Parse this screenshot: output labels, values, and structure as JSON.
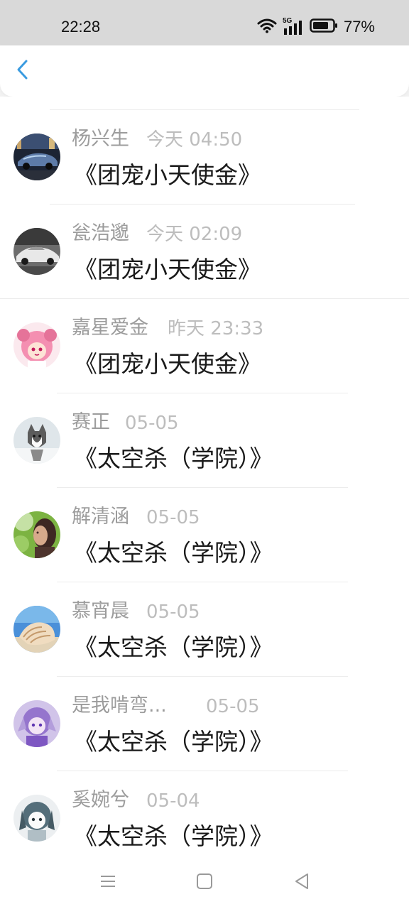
{
  "status_bar": {
    "time": "22:28",
    "battery_percent": "77%",
    "network_label": "5G"
  },
  "header": {
    "back_icon": "chevron-left-icon",
    "accent_color": "#3a9be0"
  },
  "list": {
    "items": [
      {
        "name": "杨兴生",
        "date": "今天 04:50",
        "title": "《团宠小天使金》",
        "avatar": "car-photo"
      },
      {
        "name": "瓮浩邈",
        "date": "今天 02:09",
        "title": "《团宠小天使金》",
        "avatar": "white-car-photo"
      },
      {
        "name": "嘉星爱金",
        "date": "昨天 23:33",
        "title": "《团宠小天使金》",
        "avatar": "pink-anime-girl"
      },
      {
        "name": "赛正",
        "date": "05-05",
        "title": "《太空杀（学院）》",
        "avatar": "husky-dog"
      },
      {
        "name": "解清涵",
        "date": "05-05",
        "title": "《太空杀（学院）》",
        "avatar": "woman-portrait"
      },
      {
        "name": "慕宵晨",
        "date": "05-05",
        "title": "《太空杀（学院）》",
        "avatar": "seashell-beach"
      },
      {
        "name": "是我啃弯...",
        "date": "05-05",
        "title": "《太空杀（学院）》",
        "avatar": "purple-anime-girl"
      },
      {
        "name": "奚婉兮",
        "date": "05-04",
        "title": "《太空杀（学院）》",
        "avatar": "gray-anime-girl"
      }
    ]
  },
  "nav_bar": {
    "menu_icon": "menu-icon",
    "home_icon": "home-square-icon",
    "back_icon": "back-triangle-icon"
  }
}
